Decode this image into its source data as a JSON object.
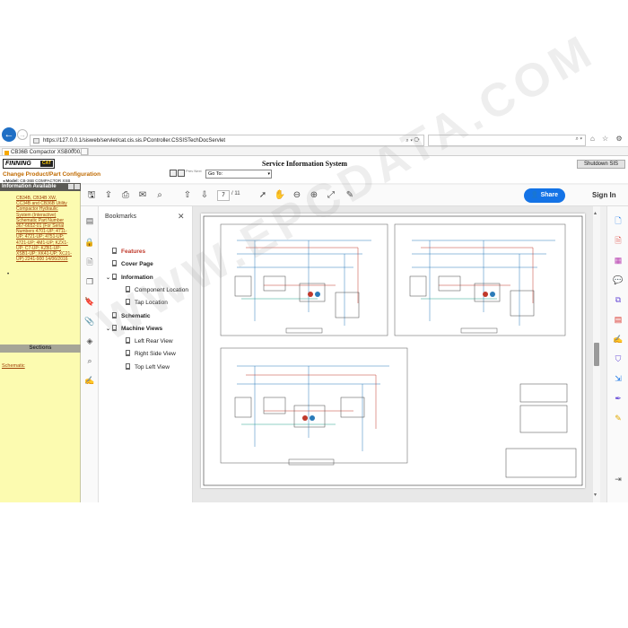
{
  "browser": {
    "url": "https://127.0.0.1/sisweb/servlet/cat.cis.sis.PController.CSSISTechDocServlet",
    "addr_controls": "⌕ ▾ ⟳",
    "search_controls": "⌕ ▾",
    "tab_title": "CB36B Compactor XSB0000...",
    "window_icons": "⌂ ☆ ⚙"
  },
  "sis": {
    "brand": "FINNING",
    "brand_badge": "CAT",
    "title": "Service Information System",
    "change_product": "Change Product/Part Configuration",
    "model_label": "Model:",
    "model_value": "CB-36B COMPACTOR XSB",
    "nav_label": "Prev Next",
    "goto_label": "Go To:",
    "shutdown": "Shutdown SIS",
    "info_header": "Information Available",
    "info_link": "CB34B, CB34B XW, CC34B and CB36B Utility Compactor Hydraulic System (Interactive) Schematic Part Number 367-6652-01 (For Serial Numbers 4701-UP; 4711-UP; 4721-UP; 4751-UP; 4721-UP; 4M1-UP; KZX1-UP; C7-UP; KZB1-UP; XSB1-UP; XK41-UP; XC21-UP) 2241-900 14/06/2016",
    "bullet": "•",
    "sections_header": "Sections",
    "section_link": "Schematic"
  },
  "acrobat": {
    "page_current": "7",
    "page_total": "/  11",
    "share": "Share",
    "sign_in": "Sign In",
    "bookmarks_title": "Bookmarks",
    "bookmarks": [
      {
        "label": "Features",
        "level": 0,
        "caret": "",
        "bold": true,
        "active": true
      },
      {
        "label": "Cover Page",
        "level": 0,
        "caret": "",
        "bold": true,
        "active": false
      },
      {
        "label": "Information",
        "level": 0,
        "caret": "⌄",
        "bold": true,
        "active": false
      },
      {
        "label": "Component Location",
        "level": 1,
        "caret": "",
        "bold": false,
        "active": false
      },
      {
        "label": "Tap Location",
        "level": 1,
        "caret": "",
        "bold": false,
        "active": false
      },
      {
        "label": "Schematic",
        "level": 0,
        "caret": "",
        "bold": true,
        "active": false
      },
      {
        "label": "Machine Views",
        "level": 0,
        "caret": "⌄",
        "bold": true,
        "active": false
      },
      {
        "label": "Left Rear View",
        "level": 1,
        "caret": "",
        "bold": false,
        "active": false
      },
      {
        "label": "Right Side View",
        "level": 1,
        "caret": "",
        "bold": false,
        "active": false
      },
      {
        "label": "Top Left View",
        "level": 1,
        "caret": "",
        "bold": false,
        "active": false
      }
    ]
  },
  "colors": {
    "accent_blue": "#1473e6",
    "link_orange": "#a0410a",
    "panel_yellow": "#fcfbb0"
  },
  "watermark": "WWW.EPCDATA.COM"
}
